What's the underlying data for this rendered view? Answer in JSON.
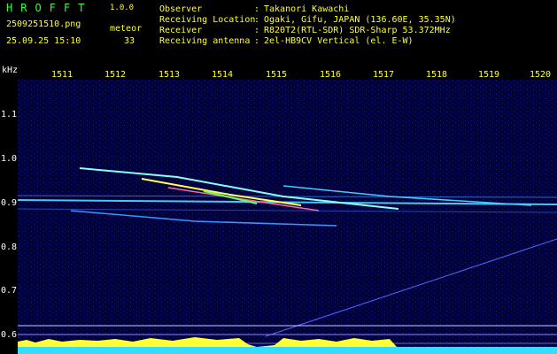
{
  "header": {
    "app_title": "HROFFT",
    "version": "1.0.0",
    "filename": "2509251510.png",
    "timestamp": "25.09.25 15:10",
    "meteor_label": "meteor",
    "meteor_count": "33"
  },
  "info": [
    {
      "key": "Observer",
      "sep": ":",
      "value": "Takanori Kawachi"
    },
    {
      "key": "Receiving Location",
      "sep": ":",
      "value": "Ogaki, Gifu, JAPAN (136.60E, 35.35N)"
    },
    {
      "key": "Receiver",
      "sep": ":",
      "value": "R820T2(RTL-SDR) SDR-Sharp 53.372MHz"
    },
    {
      "key": "Receiving antenna",
      "sep": ":",
      "value": "2el-HB9CV Vertical (el. E-W)"
    }
  ],
  "axes": {
    "y_unit": "kHz",
    "x_ticks": [
      "1511",
      "1512",
      "1513",
      "1514",
      "1515",
      "1516",
      "1517",
      "1518",
      "1519",
      "1520"
    ],
    "y_ticks": [
      "1.1",
      "1.0",
      "0.9",
      "0.8",
      "0.7",
      "0.6"
    ]
  },
  "colors": {
    "background": "#000000",
    "plot_bg": "#000033",
    "header_text": "#ffff33",
    "title_text": "#33ff33",
    "trace_cyan": "#44ffff",
    "trace_yellow": "#ffff00"
  }
}
